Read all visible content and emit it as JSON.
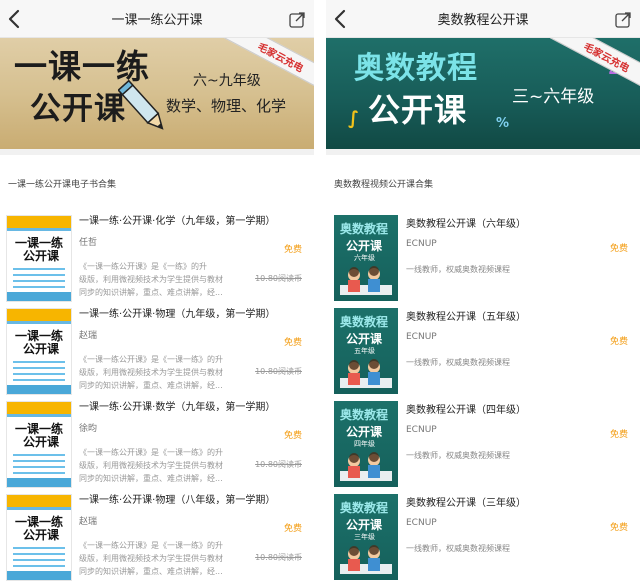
{
  "left": {
    "title": "一课一练公开课",
    "banner": {
      "line1": "一课一练",
      "line2": "公开课",
      "grade": "六~九年级",
      "subjects": "数学、物理、化学",
      "ribbon": "毛家云充电"
    },
    "section_title": "一课一练公开课电子书合集",
    "items": [
      {
        "name": "一课一练·公开课·化学（九年级，第一学期）",
        "author": "任哲",
        "price": "免费",
        "original_price": "10.80阅读币",
        "desc1": "《一课一练公开课》是《一练》的升",
        "desc2": "级版，利用微视频技术为学生提供与教材",
        "desc3": "同步的知识讲解，重点、难点讲解，经...",
        "cover_title1": "一课一练",
        "cover_title2": "公开课"
      },
      {
        "name": "一课一练·公开课·物理（九年级，第一学期）",
        "author": "赵瑞",
        "price": "免费",
        "original_price": "10.80阅读币",
        "desc1": "《一课一练公开课》是《一课一练》的升",
        "desc2": "级版，利用微视频技术为学生提供与教材",
        "desc3": "同步的知识讲解，重点、难点讲解，经...",
        "cover_title1": "一课一练",
        "cover_title2": "公开课"
      },
      {
        "name": "一课一练·公开课·数学（九年级，第一学期）",
        "author": "徐昀",
        "price": "免费",
        "original_price": "10.80阅读币",
        "desc1": "《一课一练公开课》是《一课一练》的升",
        "desc2": "级版，利用微视频技术为学生提供与教材",
        "desc3": "同步的知识讲解，重点、难点讲解，经...",
        "cover_title1": "一课一练",
        "cover_title2": "公开课"
      },
      {
        "name": "一课一练·公开课·物理（八年级，第一学期）",
        "author": "赵瑞",
        "price": "免费",
        "original_price": "10.80阅读币",
        "desc1": "《一课一练公开课》是《一课一练》的升",
        "desc2": "级版，利用微视频技术为学生提供与教材",
        "desc3": "同步的知识讲解，重点、难点讲解，经...",
        "cover_title1": "一课一练",
        "cover_title2": "公开课"
      }
    ]
  },
  "right": {
    "title": "奥数教程公开课",
    "banner": {
      "line1": "奥数教程",
      "line2": "公开课",
      "grade": "三~六年级",
      "ribbon": "毛家云充电"
    },
    "section_title": "奥数教程视频公开课合集",
    "items": [
      {
        "name": "奥数教程公开课（六年级）",
        "author": "ECNUP",
        "price": "免费",
        "desc": "一线教师，权威奥数视频课程",
        "cover_grade": "六年级"
      },
      {
        "name": "奥数教程公开课（五年级）",
        "author": "ECNUP",
        "price": "免费",
        "desc": "一线教师，权威奥数视频课程",
        "cover_grade": "五年级"
      },
      {
        "name": "奥数教程公开课（四年级）",
        "author": "ECNUP",
        "price": "免费",
        "desc": "一线教师，权威奥数视频课程",
        "cover_grade": "四年级"
      },
      {
        "name": "奥数教程公开课（三年级）",
        "author": "ECNUP",
        "price": "免费",
        "desc": "一线教师，权威奥数视频课程",
        "cover_grade": "三年级"
      }
    ],
    "cover_title1": "奥数教程",
    "cover_title2": "公开课"
  },
  "colors": {
    "accent_price": "#f39c12",
    "ribbon_text": "#d62f2f",
    "left_banner": "#d6c090",
    "right_banner": "#175b57"
  },
  "icons": {
    "back": "chevron-left-icon",
    "share": "share-icon",
    "pencil": "pencil-icon"
  }
}
